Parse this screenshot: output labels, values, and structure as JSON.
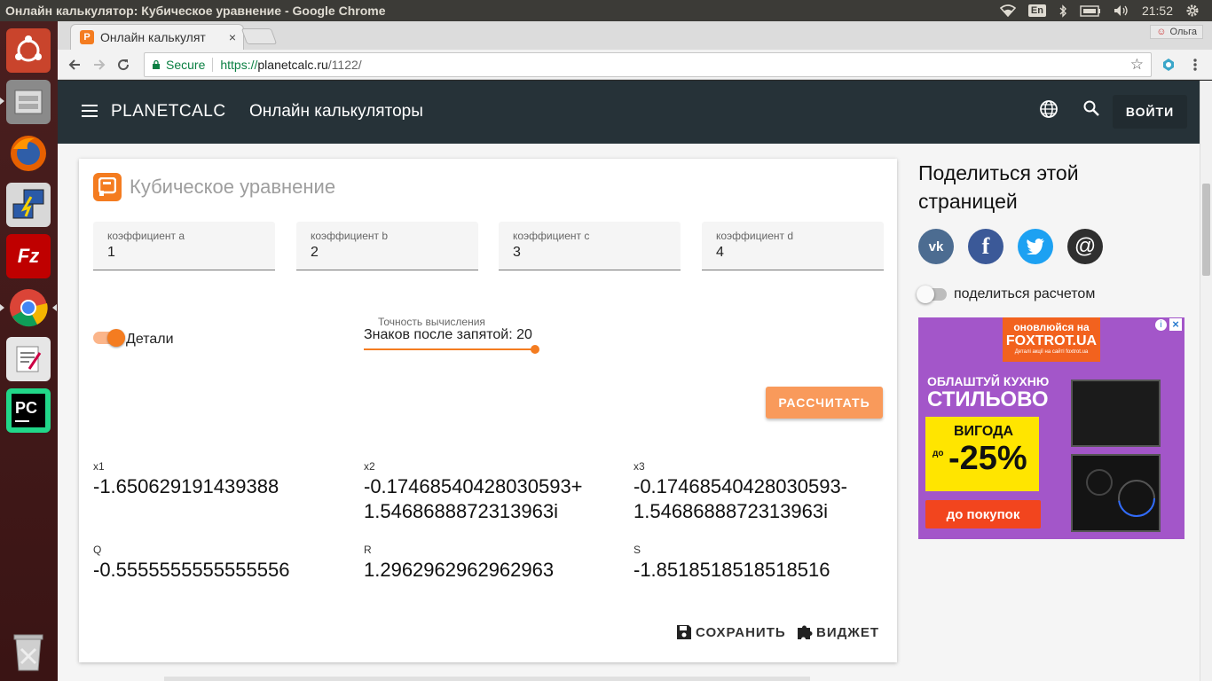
{
  "os": {
    "window_title": "Онлайн калькулятор: Кубическое уравнение - Google Chrome",
    "lang": "En",
    "clock": "21:52"
  },
  "browser": {
    "tab_title": "Онлайн калькулят",
    "tab_close": "×",
    "user_name": "Ольга",
    "secure_label": "Secure",
    "url_scheme": "https://",
    "url_host": "planetcalc.ru",
    "url_path": "/1122/"
  },
  "header": {
    "brand": "PLANETCALC",
    "subtitle": "Онлайн калькуляторы",
    "login_label": "ВОЙТИ"
  },
  "calculator": {
    "title": "Кубическое уравнение",
    "fields": [
      {
        "label": "коэффициент a",
        "value": "1"
      },
      {
        "label": "коэффициент b",
        "value": "2"
      },
      {
        "label": "коэффициент c",
        "value": "3"
      },
      {
        "label": "коэффициент d",
        "value": "4"
      }
    ],
    "details_label": "Детали",
    "details_on": true,
    "precision_label": "Точность вычисления",
    "precision_value": "Знаков после запятой: 20",
    "precision_fraction": 1.0,
    "calculate_label": "РАССЧИТАТЬ",
    "results": [
      {
        "label": "x1",
        "value": "-1.650629191439388"
      },
      {
        "label": "x2",
        "value": "-0.17468540428030593+ 1.5468688872313963i"
      },
      {
        "label": "x3",
        "value": "-0.17468540428030593- 1.5468688872313963i"
      },
      {
        "label": "Q",
        "value": "-0.5555555555555556"
      },
      {
        "label": "R",
        "value": "1.2962962962962963"
      },
      {
        "label": "S",
        "value": "-1.8518518518518516"
      }
    ],
    "save_label": "СОХРАНИТЬ",
    "widget_label": "ВИДЖЕТ"
  },
  "sidebar": {
    "share_title": "Поделиться этой страницей",
    "share_calc_label": "поделиться расчетом",
    "share_calc_on": false,
    "social": [
      "vk-icon",
      "facebook-icon",
      "twitter-icon",
      "email-icon"
    ]
  },
  "ad": {
    "line1": "оновлюйся на",
    "line2": "FOXTROT.UA",
    "line3": "Деталі акції на сайті foxtrot.ua",
    "heading1": "ОБЛАШТУЙ КУХНЮ",
    "heading2": "СТИЛЬОВО",
    "promo1": "ВИГОДА",
    "promo2": "до",
    "promo3": "-25%",
    "cta": "до покупок"
  },
  "colors": {
    "accent": "#f47c20",
    "appbar": "#263238",
    "vk": "#4c6c91",
    "facebook": "#3b5998",
    "twitter": "#1da1f2",
    "email": "#2f2f2f"
  }
}
